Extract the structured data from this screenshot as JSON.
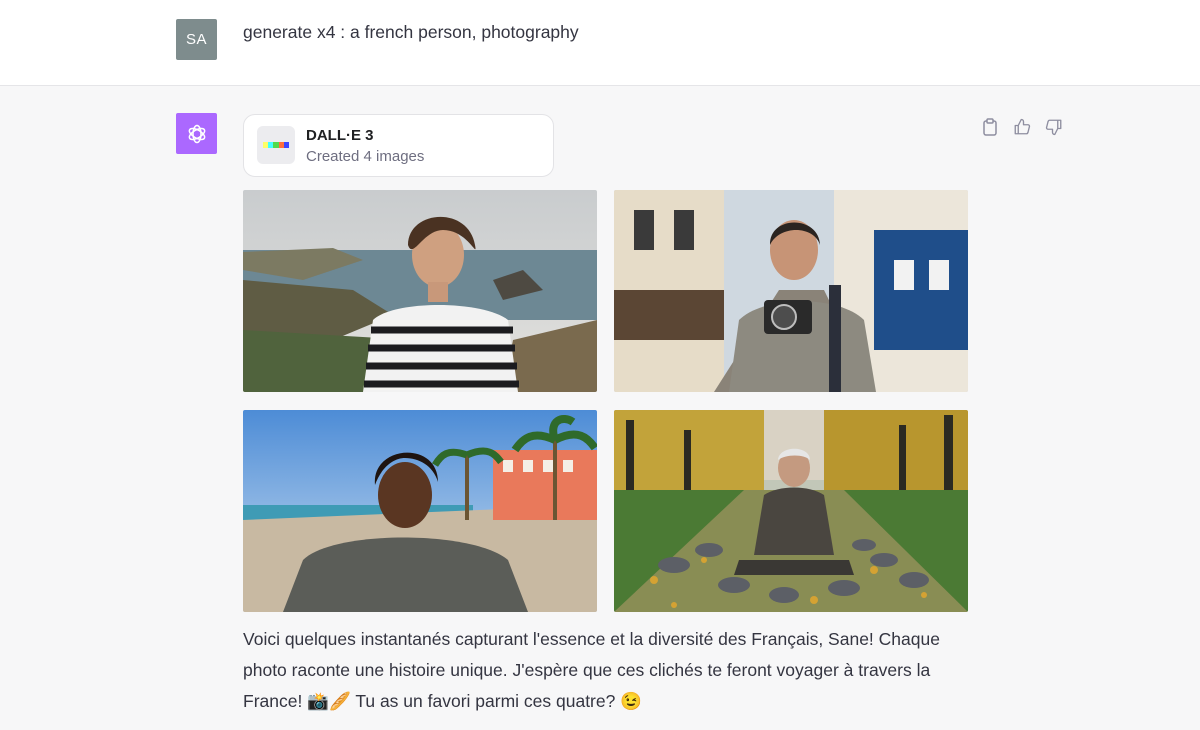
{
  "user": {
    "avatar_initials": "SA",
    "message": "generate x4 : a french person, photography"
  },
  "assistant": {
    "avatar_icon": "openai-logo-icon",
    "tool": {
      "name": "DALL·E 3",
      "status": "Created 4 images",
      "icon": "dalle-icon"
    },
    "actions": [
      {
        "name": "copy-icon"
      },
      {
        "name": "thumbs-up-icon"
      },
      {
        "name": "thumbs-down-icon"
      }
    ],
    "images": [
      {
        "subject": "woman-striped-shirt-coast"
      },
      {
        "subject": "man-camera-paris-street"
      },
      {
        "subject": "teen-beach-palm-trees"
      },
      {
        "subject": "old-man-pigeons-park"
      }
    ],
    "reply": "Voici quelques instantanés capturant l'essence et la diversité des Français, Sane! Chaque photo raconte une histoire unique. J'espère que ces clichés te feront voyager à travers la France! 📸🥖 Tu as un favori parmi ces quatre? 😉"
  },
  "colors": {
    "bot_avatar": "#ab68ff",
    "user_avatar": "#7e8c8d",
    "page_bg": "#f7f7f8"
  }
}
